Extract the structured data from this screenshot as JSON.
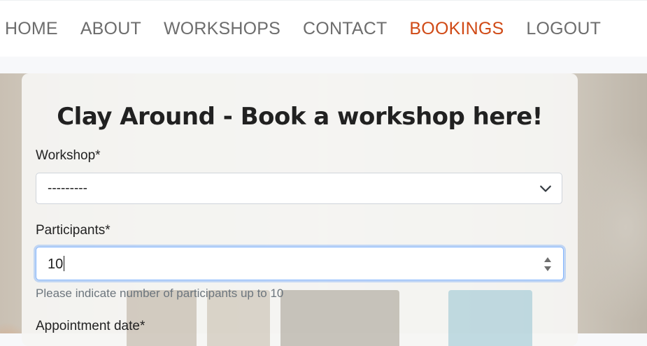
{
  "nav": {
    "items": [
      {
        "label": "HOME"
      },
      {
        "label": "ABOUT"
      },
      {
        "label": "WORKSHOPS"
      },
      {
        "label": "CONTACT"
      },
      {
        "label": "BOOKINGS",
        "active": true
      },
      {
        "label": "LOGOUT"
      }
    ],
    "active_color": "#d04a16",
    "color": "#6d6d6d"
  },
  "form": {
    "title": "Clay Around - Book a workshop here!",
    "workshop_label": "Workshop*",
    "workshop_value": "---------",
    "workshop_icon": "chevron-down-icon",
    "participants_label": "Participants*",
    "participants_value": "10",
    "participants_help": "Please indicate number of participants up to 10",
    "appointment_label": "Appointment date*"
  }
}
